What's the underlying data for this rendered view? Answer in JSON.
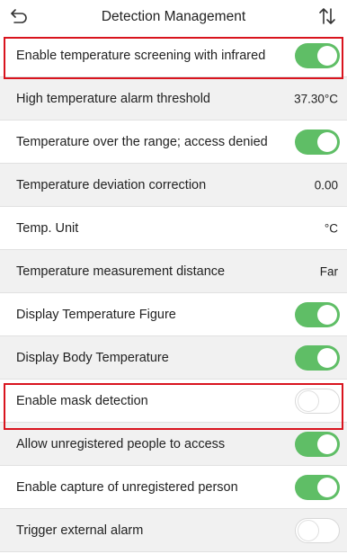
{
  "header": {
    "title": "Detection Management",
    "back_icon": "back-arrow-icon",
    "sort_icon": "sort-icon"
  },
  "rows": [
    {
      "label": "Enable temperature screening with infrared",
      "type": "toggle",
      "state": "on"
    },
    {
      "label": "High temperature alarm threshold",
      "type": "value",
      "value": "37.30°C"
    },
    {
      "label": "Temperature over the range; access denied",
      "type": "toggle",
      "state": "on"
    },
    {
      "label": "Temperature deviation correction",
      "type": "value",
      "value": "0.00"
    },
    {
      "label": "Temp. Unit",
      "type": "value",
      "value": "°C"
    },
    {
      "label": "Temperature measurement distance",
      "type": "value",
      "value": "Far"
    },
    {
      "label": "Display Temperature Figure",
      "type": "toggle",
      "state": "on"
    },
    {
      "label": "Display Body Temperature",
      "type": "toggle",
      "state": "on"
    },
    {
      "label": "Enable mask detection",
      "type": "toggle",
      "state": "off"
    },
    {
      "label": "Allow unregistered people to access",
      "type": "toggle",
      "state": "on"
    },
    {
      "label": "Enable capture of unregistered person",
      "type": "toggle",
      "state": "on"
    },
    {
      "label": "Trigger external alarm",
      "type": "toggle",
      "state": "off"
    }
  ],
  "colors": {
    "toggle_on": "#5fbe66",
    "highlight": "#d9141e",
    "alt_row": "#f1f1f1"
  }
}
